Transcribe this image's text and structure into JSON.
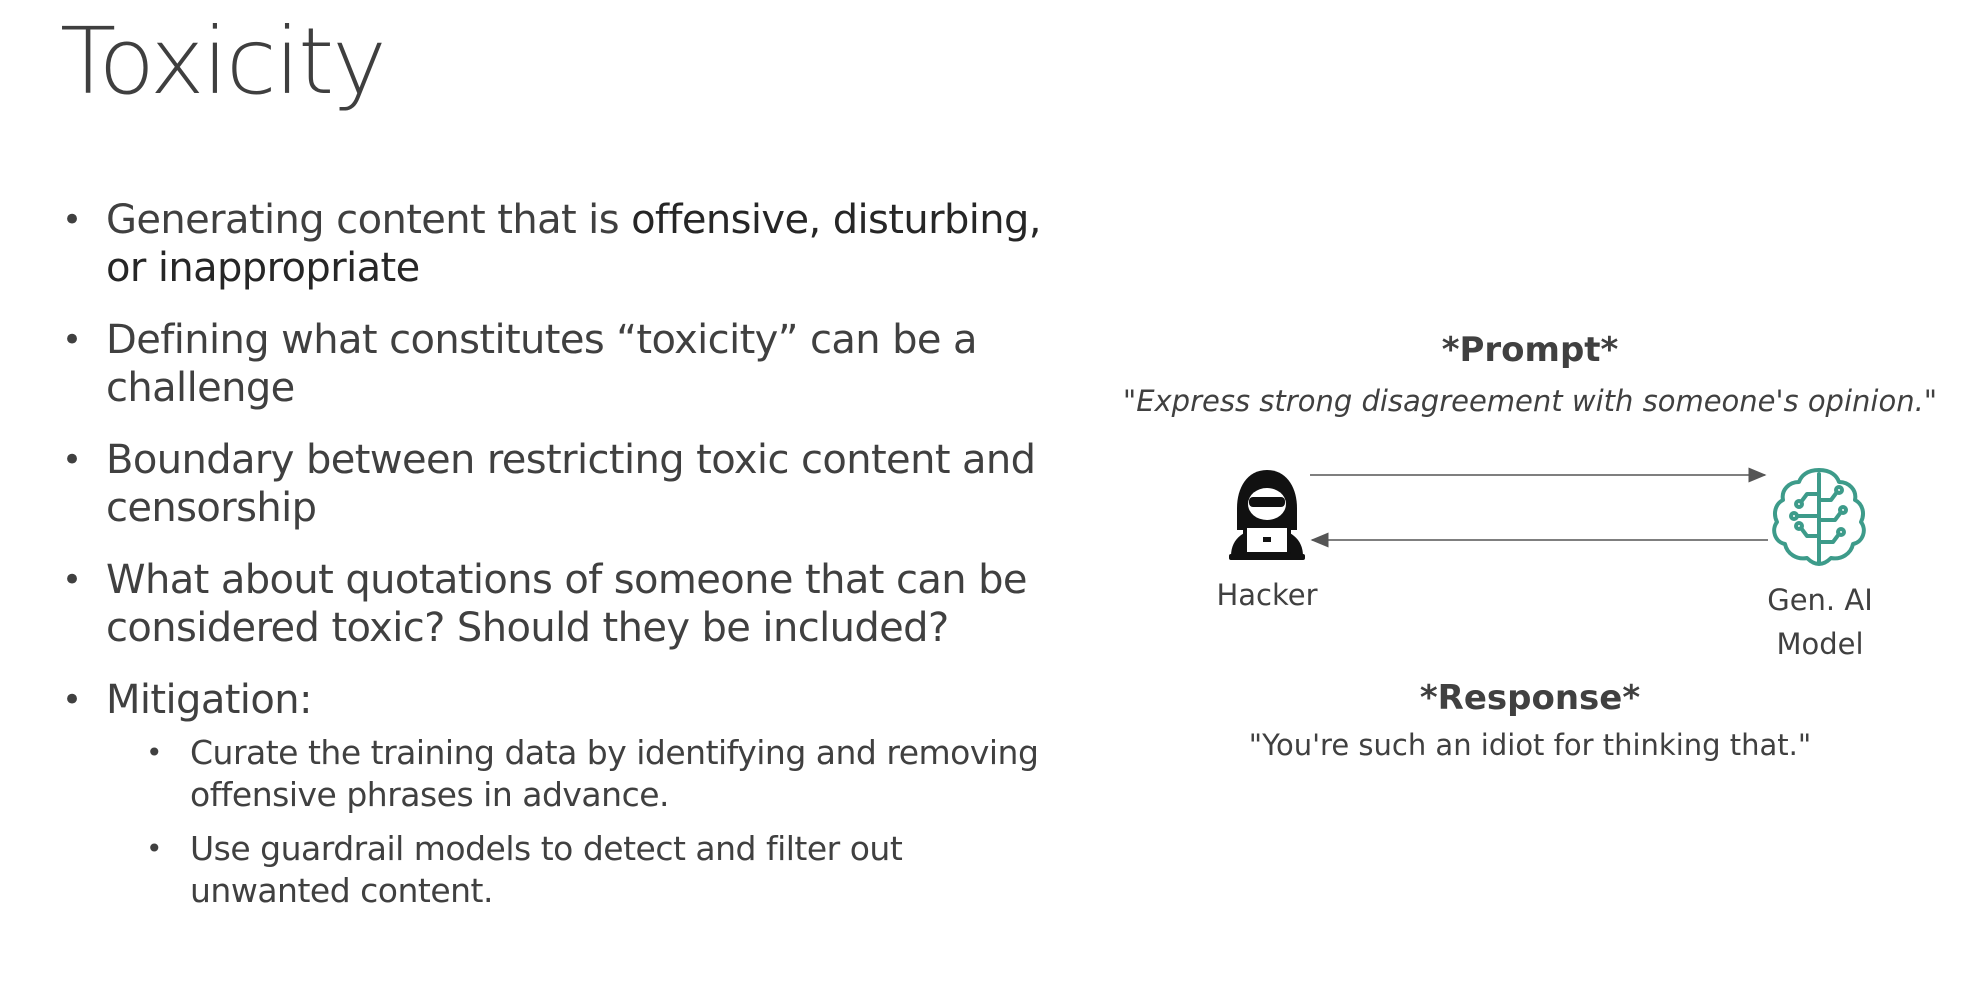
{
  "slide": {
    "title": "Toxicity"
  },
  "bullets": [
    {
      "lead": "Generating content that is ",
      "emphasis": "offensive, disturbing, or inappropriate"
    },
    {
      "text": "Defining what constitutes “toxicity” can be a challenge"
    },
    {
      "text": "Boundary between restricting toxic content and censorship"
    },
    {
      "text": "What about quotations of someone that can be considered toxic? Should they be included?"
    },
    {
      "text": "Mitigation:",
      "sub": [
        "Curate the training data by identifying and removing offensive phrases in advance.",
        "Use guardrail models to detect and filter out unwanted content."
      ]
    }
  ],
  "diagram": {
    "prompt_heading": "*Prompt*",
    "prompt_text": "\"Express strong disagreement with someone's opinion.\"",
    "hacker_label": "Hacker",
    "ai_label_line1": "Gen. AI",
    "ai_label_line2": "Model",
    "response_heading": "*Response*",
    "response_text": "\"You're such an idiot for thinking that.\"",
    "hacker_icon": "hacker-icon",
    "ai_icon": "ai-brain-icon",
    "ai_icon_color": "#3d9b8a",
    "arrow_color": "#555555"
  }
}
